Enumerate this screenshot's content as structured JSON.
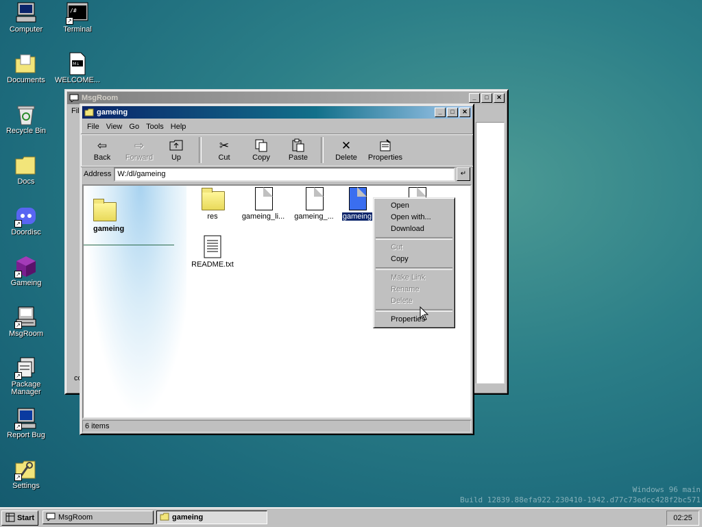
{
  "desktop": {
    "icons": [
      {
        "label": "Computer"
      },
      {
        "label": "Terminal"
      },
      {
        "label": "Documents"
      },
      {
        "label": "WELCOME..."
      },
      {
        "label": "Recycle Bin"
      },
      {
        "label": "Docs"
      },
      {
        "label": "Doordisc"
      },
      {
        "label": "Gameing"
      },
      {
        "label": "MsgRoom"
      },
      {
        "label": "Package Manager"
      },
      {
        "label": "Report Bug"
      },
      {
        "label": "Settings"
      }
    ],
    "watermark_line1": "Windows 96 main",
    "watermark_line2": "Build 12839.88efa922.230410-1942.d77c73edcc428f2bc571"
  },
  "msgroom_window": {
    "title": "MsgRoom",
    "menu_first": "File",
    "status_fragment": "co"
  },
  "explorer": {
    "title": "gameing",
    "menu": [
      "File",
      "View",
      "Go",
      "Tools",
      "Help"
    ],
    "toolbar": {
      "back": "Back",
      "forward": "Forward",
      "up": "Up",
      "cut": "Cut",
      "copy": "Copy",
      "paste": "Paste",
      "delete": "Delete",
      "properties": "Properties"
    },
    "address_label": "Address",
    "address_value": "W:/dl/gameing",
    "side_title": "gameing",
    "files": [
      {
        "label": "res"
      },
      {
        "label": "gameing_li..."
      },
      {
        "label": "gameing_..."
      },
      {
        "label": "gameing"
      },
      {
        "label": "README.txt"
      }
    ],
    "status": "6 items"
  },
  "context_menu": {
    "open": "Open",
    "open_with": "Open with...",
    "download": "Download",
    "cut": "Cut",
    "copy": "Copy",
    "make_link": "Make Link",
    "rename": "Rename",
    "delete": "Delete",
    "properties": "Properties"
  },
  "taskbar": {
    "start": "Start",
    "tasks": [
      {
        "label": "MsgRoom"
      },
      {
        "label": "gameing"
      }
    ],
    "clock": "02:25"
  },
  "colors": {
    "title_active": "#0a246a",
    "desktop": "#2c7f88",
    "selection": "#0a246a"
  }
}
